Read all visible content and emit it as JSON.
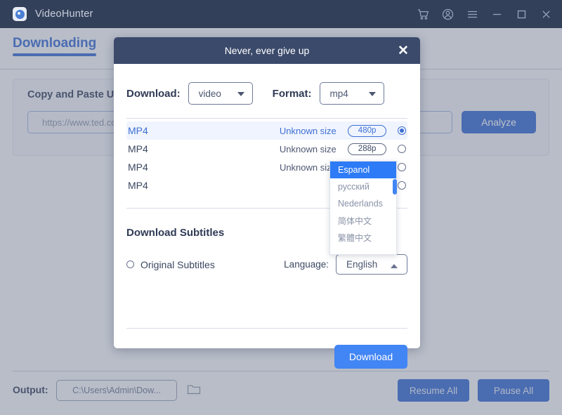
{
  "titlebar": {
    "app_name": "VideoHunter",
    "logo_icon": "videohunter-logo-icon",
    "icons": [
      {
        "name": "cart-icon",
        "glyph": "cart"
      },
      {
        "name": "account-icon",
        "glyph": "account"
      },
      {
        "name": "menu-icon",
        "glyph": "menu"
      },
      {
        "name": "minimize-icon",
        "glyph": "minimize"
      },
      {
        "name": "maximize-icon",
        "glyph": "maximize"
      },
      {
        "name": "close-icon",
        "glyph": "close"
      }
    ],
    "bg_color": "#334059"
  },
  "tabs": [
    {
      "label": "Downloading",
      "active": true
    }
  ],
  "main": {
    "card_title": "Copy and Paste U",
    "url_placeholder": "https://www.ted.com,",
    "analyze_label": "Analyze"
  },
  "bottom": {
    "output_label": "Output:",
    "output_path": "C:\\Users\\Admin\\Dow...",
    "folder_icon": "folder-icon",
    "resume_all_label": "Resume All",
    "pause_all_label": "Pause All"
  },
  "modal": {
    "title": "Never, ever give up",
    "close_icon": "close-icon",
    "download_type_label": "Download:",
    "download_type_value": "video",
    "format_label": "Format:",
    "format_value": "mp4",
    "streams": [
      {
        "format": "MP4",
        "size": "Unknown size",
        "quality": "480p",
        "selected": true
      },
      {
        "format": "MP4",
        "size": "Unknown size",
        "quality": "288p",
        "selected": false
      },
      {
        "format": "MP4",
        "size": "Unknown size",
        "quality": "",
        "selected": false
      },
      {
        "format": "MP4",
        "size": "",
        "quality": "",
        "selected": false
      }
    ],
    "subtitles_title": "Download Subtitles",
    "original_subtitles_label": "Original Subtitles",
    "original_subtitles_checked": false,
    "language_label": "Language:",
    "language_value": "English",
    "language_options": [
      {
        "label": "Espanol",
        "highlighted": true
      },
      {
        "label": "русский",
        "highlighted": false
      },
      {
        "label": "Nederlands",
        "highlighted": false
      },
      {
        "label": "简体中文",
        "highlighted": false
      },
      {
        "label": "繁體中文",
        "highlighted": false
      }
    ],
    "download_button_label": "Download",
    "accent_color": "#4285f4",
    "header_color": "#3b4a6b"
  }
}
